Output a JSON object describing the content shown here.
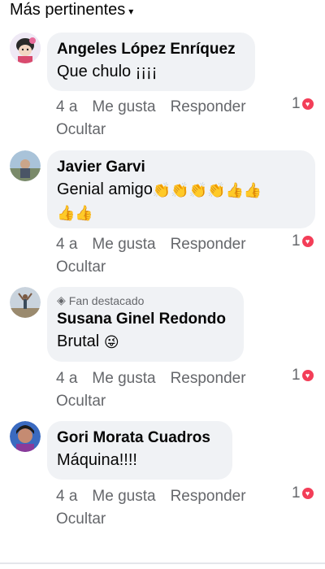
{
  "sort": {
    "label": "Más pertinentes"
  },
  "comments": [
    {
      "author": "Angeles López Enríquez",
      "text": "Que chulo ¡¡¡¡",
      "time": "4 a",
      "like": "Me gusta",
      "reply": "Responder",
      "hide": "Ocultar",
      "reactions": "1"
    },
    {
      "author": "Javier Garvi",
      "text": "Genial amigo",
      "time": "4 a",
      "like": "Me gusta",
      "reply": "Responder",
      "hide": "Ocultar",
      "reactions": "1"
    },
    {
      "badge": "Fan destacado",
      "author": "Susana Ginel Redondo",
      "text": "Brutal",
      "time": "4 a",
      "like": "Me gusta",
      "reply": "Responder",
      "hide": "Ocultar",
      "reactions": "1"
    },
    {
      "author": "Gori Morata Cuadros",
      "text": "Máquina!!!!",
      "time": "4 a",
      "like": "Me gusta",
      "reply": "Responder",
      "hide": "Ocultar",
      "reactions": "1"
    }
  ],
  "colors": {
    "bubble": "#f0f2f5",
    "meta": "#65676b",
    "heart": "#f33e58"
  },
  "icons": [
    "chevron-down-icon",
    "heart-reaction-icon",
    "diamond-icon",
    "clap-emoji",
    "thumbs-up-emoji",
    "winking-tongue-emoji"
  ]
}
